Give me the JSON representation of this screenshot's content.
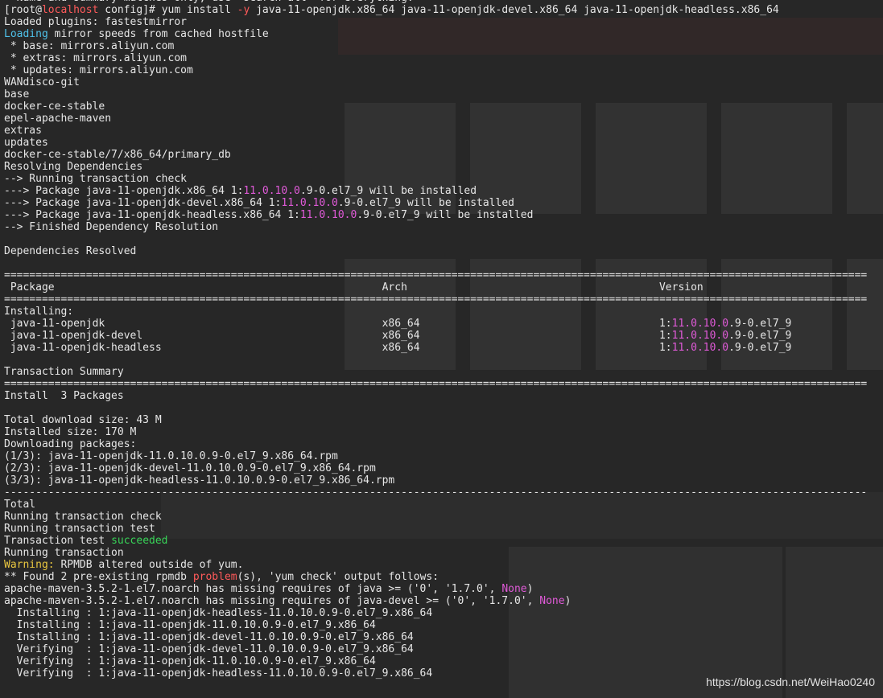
{
  "terminal": {
    "lines": [
      {
        "type": "plain",
        "text": "  Name and summary matches only, use \"search all\" for everything."
      },
      {
        "type": "prompt",
        "user": "root",
        "host": "localhost",
        "dir": "config",
        "cmd": "yum install ",
        "flag": "-y",
        "rest": " java-11-openjdk.x86_64 java-11-openjdk-devel.x86_64 java-11-openjdk-headless.x86_64"
      },
      {
        "type": "plain",
        "text": "Loaded plugins: fastestmirror"
      },
      {
        "type": "loading",
        "head": "Loading",
        "text": " mirror speeds from cached hostfile"
      },
      {
        "type": "plain",
        "text": " * base: mirrors.aliyun.com"
      },
      {
        "type": "plain",
        "text": " * extras: mirrors.aliyun.com"
      },
      {
        "type": "plain",
        "text": " * updates: mirrors.aliyun.com"
      },
      {
        "type": "plain",
        "text": "WANdisco-git"
      },
      {
        "type": "plain",
        "text": "base"
      },
      {
        "type": "plain",
        "text": "docker-ce-stable"
      },
      {
        "type": "plain",
        "text": "epel-apache-maven"
      },
      {
        "type": "plain",
        "text": "extras"
      },
      {
        "type": "plain",
        "text": "updates"
      },
      {
        "type": "plain",
        "text": "docker-ce-stable/7/x86_64/primary_db"
      },
      {
        "type": "plain",
        "text": "Resolving Dependencies"
      },
      {
        "type": "plain",
        "text": "--> Running transaction check"
      },
      {
        "type": "ver",
        "pre": "---> Package java-11-openjdk.x86_64 1:",
        "ver": "11.0.10.0",
        "post": ".9-0.el7_9 will be installed"
      },
      {
        "type": "ver",
        "pre": "---> Package java-11-openjdk-devel.x86_64 1:",
        "ver": "11.0.10.0",
        "post": ".9-0.el7_9 will be installed"
      },
      {
        "type": "ver",
        "pre": "---> Package java-11-openjdk-headless.x86_64 1:",
        "ver": "11.0.10.0",
        "post": ".9-0.el7_9 will be installed"
      },
      {
        "type": "plain",
        "text": "--> Finished Dependency Resolution"
      },
      {
        "type": "plain",
        "text": ""
      },
      {
        "type": "plain",
        "text": "Dependencies Resolved"
      },
      {
        "type": "plain",
        "text": ""
      },
      {
        "type": "plain",
        "text": "========================================================================================================================================="
      },
      {
        "type": "plain",
        "text": " Package                                                    Arch                                        Version"
      },
      {
        "type": "plain",
        "text": "========================================================================================================================================="
      },
      {
        "type": "plain",
        "text": "Installing:"
      },
      {
        "type": "ver",
        "pre": " java-11-openjdk                                            x86_64                                      1:",
        "ver": "11.0.10.0",
        "post": ".9-0.el7_9"
      },
      {
        "type": "ver",
        "pre": " java-11-openjdk-devel                                      x86_64                                      1:",
        "ver": "11.0.10.0",
        "post": ".9-0.el7_9"
      },
      {
        "type": "ver",
        "pre": " java-11-openjdk-headless                                   x86_64                                      1:",
        "ver": "11.0.10.0",
        "post": ".9-0.el7_9"
      },
      {
        "type": "plain",
        "text": ""
      },
      {
        "type": "plain",
        "text": "Transaction Summary"
      },
      {
        "type": "plain",
        "text": "========================================================================================================================================="
      },
      {
        "type": "plain",
        "text": "Install  3 Packages"
      },
      {
        "type": "plain",
        "text": ""
      },
      {
        "type": "plain",
        "text": "Total download size: 43 M"
      },
      {
        "type": "plain",
        "text": "Installed size: 170 M"
      },
      {
        "type": "plain",
        "text": "Downloading packages:"
      },
      {
        "type": "plain",
        "text": "(1/3): java-11-openjdk-11.0.10.0.9-0.el7_9.x86_64.rpm"
      },
      {
        "type": "plain",
        "text": "(2/3): java-11-openjdk-devel-11.0.10.0.9-0.el7_9.x86_64.rpm"
      },
      {
        "type": "plain",
        "text": "(3/3): java-11-openjdk-headless-11.0.10.0.9-0.el7_9.x86_64.rpm"
      },
      {
        "type": "plain",
        "text": "-----------------------------------------------------------------------------------------------------------------------------------------"
      },
      {
        "type": "plain",
        "text": "Total"
      },
      {
        "type": "plain",
        "text": "Running transaction check"
      },
      {
        "type": "plain",
        "text": "Running transaction test"
      },
      {
        "type": "succ",
        "pre": "Transaction test ",
        "word": "succeeded"
      },
      {
        "type": "plain",
        "text": "Running transaction"
      },
      {
        "type": "warn",
        "head": "Warning:",
        "text": " RPMDB altered outside of yum."
      },
      {
        "type": "prob",
        "pre": "** Found 2 pre-existing rpmdb ",
        "word": "problem",
        "post": "(s), 'yum check' output follows:"
      },
      {
        "type": "none",
        "pre": "apache-maven-3.5.2-1.el7.noarch has missing requires of java >= ('0', '1.7.0', ",
        "word": "None",
        "post": ")"
      },
      {
        "type": "none",
        "pre": "apache-maven-3.5.2-1.el7.noarch has missing requires of java-devel >= ('0', '1.7.0', ",
        "word": "None",
        "post": ")"
      },
      {
        "type": "plain",
        "text": "  Installing : 1:java-11-openjdk-headless-11.0.10.0.9-0.el7_9.x86_64"
      },
      {
        "type": "plain",
        "text": "  Installing : 1:java-11-openjdk-11.0.10.0.9-0.el7_9.x86_64"
      },
      {
        "type": "plain",
        "text": "  Installing : 1:java-11-openjdk-devel-11.0.10.0.9-0.el7_9.x86_64"
      },
      {
        "type": "plain",
        "text": "  Verifying  : 1:java-11-openjdk-devel-11.0.10.0.9-0.el7_9.x86_64"
      },
      {
        "type": "plain",
        "text": "  Verifying  : 1:java-11-openjdk-11.0.10.0.9-0.el7_9.x86_64"
      },
      {
        "type": "plain",
        "text": "  Verifying  : 1:java-11-openjdk-headless-11.0.10.0.9-0.el7_9.x86_64"
      }
    ]
  },
  "watermark": "https://blog.csdn.net/WeiHao0240",
  "colors": {
    "background": "#272727",
    "text": "#e6e6e6",
    "host": "#ff5a5a",
    "loading": "#4fc1e9",
    "version": "#e05ad8",
    "success": "#38d458",
    "warning": "#e8c640"
  }
}
